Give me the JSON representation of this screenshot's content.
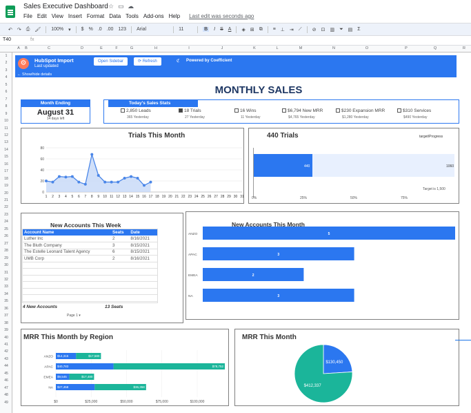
{
  "app": {
    "title": "Sales Executive Dashboard",
    "menus": [
      "File",
      "Edit",
      "View",
      "Insert",
      "Format",
      "Data",
      "Tools",
      "Add-ons",
      "Help"
    ],
    "last_edit": "Last edit was seconds ago",
    "cell_ref": "T40",
    "fx": "fx",
    "accent": "#2b77f0"
  },
  "toolbar": {
    "zoom": "100%",
    "currency": "$",
    "percent": "%",
    "dec_less": ".0",
    "dec_more": ".00",
    "format": "123",
    "font": "Arial",
    "size": "11",
    "bold": "B",
    "italic": "I",
    "strike": "S",
    "text_color": "A"
  },
  "columns": [
    "A",
    "B",
    "C",
    "D",
    "E",
    "F",
    "G",
    "H",
    "I",
    "J",
    "K",
    "L",
    "M",
    "N",
    "O",
    "P",
    "Q",
    "R",
    "S"
  ],
  "rows": [
    "1",
    "2",
    "3",
    "4",
    "5",
    "6",
    "7",
    "8",
    "9",
    "10",
    "11",
    "12",
    "13",
    "14",
    "15",
    "16",
    "17",
    "18",
    "19",
    "20",
    "21",
    "22",
    "23",
    "24",
    "25",
    "26",
    "27",
    "28",
    "29",
    "30",
    "31",
    "32",
    "33",
    "34",
    "35",
    "36",
    "37",
    "38",
    "39",
    "40",
    "41",
    "42",
    "43",
    "44",
    "45",
    "46",
    "47",
    "48",
    "49"
  ],
  "banner": {
    "title": "HubSpot Import",
    "subtitle": "Last updated",
    "open_sidebar": "Open Sidebar",
    "refresh": "Refresh",
    "powered": "Powered by Coefficient",
    "show_hide": "← Show/hide details"
  },
  "page_title": "MONTHLY SALES",
  "month_ending": {
    "label": "Month Ending",
    "date": "August 31",
    "days_left": "14 days left"
  },
  "todays_stats": {
    "label": "Today's Sales Stats",
    "items": [
      {
        "text": "2,850 Leads",
        "sub": "365 Yesterday",
        "checked": false
      },
      {
        "text": "18 Trials",
        "sub": "27 Yesterday",
        "checked": true
      },
      {
        "text": "16 Wins",
        "sub": "11 Yesterday",
        "checked": false
      },
      {
        "text": "$6,794 New MRR",
        "sub": "$4,765 Yesterday",
        "checked": false
      },
      {
        "text": "$230 Expansion MRR",
        "sub": "$1,280 Yesterday",
        "checked": false
      },
      {
        "text": "$310 Services",
        "sub": "$490 Yesterday",
        "checked": false
      }
    ]
  },
  "trials_chart_title": "Trials This Month",
  "trials_gauge": {
    "title": "440 Trials",
    "legend": "target/Progress",
    "value_label": "440",
    "target_label": "1060",
    "target_note": "Target is 1,500",
    "ticks": [
      "0%",
      "25%",
      "50%",
      "75%"
    ]
  },
  "new_accounts_week": {
    "title": "New Accounts This Week",
    "columns": [
      "Account Name",
      "Seats",
      "Date"
    ],
    "rows": [
      [
        "Luther Inc",
        "2",
        "8/16/2021"
      ],
      [
        "The Bluth Company",
        "3",
        "8/15/2021"
      ],
      [
        "The Estelle Leonard Talent Agency",
        "6",
        "8/15/2021"
      ],
      [
        "UMB Corp",
        "2",
        "8/16/2021"
      ]
    ],
    "footer_accounts": "4 New Accounts",
    "footer_seats": "13 Seats",
    "page": "Page 1"
  },
  "new_accounts_month_title": "New Accounts This Month",
  "mrr_region_title": "MRR This Month by Region",
  "mrr_month_title": "MRR This Month",
  "chart_data": [
    {
      "type": "line",
      "title": "Trials This Month",
      "x": [
        1,
        2,
        3,
        4,
        5,
        6,
        7,
        8,
        9,
        10,
        11,
        12,
        13,
        14,
        15,
        16,
        17
      ],
      "x_ticks": [
        "1",
        "2",
        "3",
        "4",
        "5",
        "6",
        "7",
        "8",
        "9",
        "10",
        "11",
        "12",
        "13",
        "14",
        "15",
        "16",
        "17",
        "18",
        "19",
        "20",
        "21",
        "22",
        "23",
        "24",
        "25",
        "26",
        "27",
        "28",
        "29",
        "30",
        "31"
      ],
      "values": [
        20,
        18,
        28,
        27,
        28,
        18,
        14,
        68,
        30,
        18,
        18,
        18,
        25,
        28,
        25,
        12,
        18
      ],
      "ylim": [
        0,
        80
      ],
      "y_ticks": [
        "0",
        "20",
        "40",
        "60",
        "80"
      ],
      "color": "#4a86e8"
    },
    {
      "type": "bar",
      "title": "New Accounts This Month",
      "orientation": "horizontal",
      "categories": [
        "ANZO",
        "APAC",
        "EMEA",
        "NA"
      ],
      "values": [
        5,
        3,
        2,
        3
      ],
      "color": "#2b77f0"
    },
    {
      "type": "bar",
      "title": "MRR This Month by Region",
      "orientation": "horizontal",
      "stacked": true,
      "categories": [
        "ANZO",
        "APAC",
        "EMEA",
        "NA"
      ],
      "series": [
        {
          "values": [
            14315,
            40783,
            9545,
            27458
          ],
          "labels": [
            "$14,315",
            "$40,783",
            "$9,545",
            "$27,458"
          ],
          "color": "#2b77f0"
        },
        {
          "values": [
            17580,
            78752,
            17480,
            36358
          ],
          "labels": [
            "$17,580",
            "$78,752",
            "$17,480",
            "$36,358"
          ],
          "color": "#1bb59a"
        }
      ],
      "x_ticks": [
        "$0",
        "$25,000",
        "$50,000",
        "$75,000",
        "$100,000"
      ],
      "xlim": [
        0,
        120000
      ]
    },
    {
      "type": "pie",
      "title": "MRR This Month",
      "values": [
        130450,
        412337
      ],
      "labels": [
        "$130,450",
        "$412,337"
      ],
      "colors": [
        "#2b77f0",
        "#1bb59a"
      ]
    }
  ]
}
